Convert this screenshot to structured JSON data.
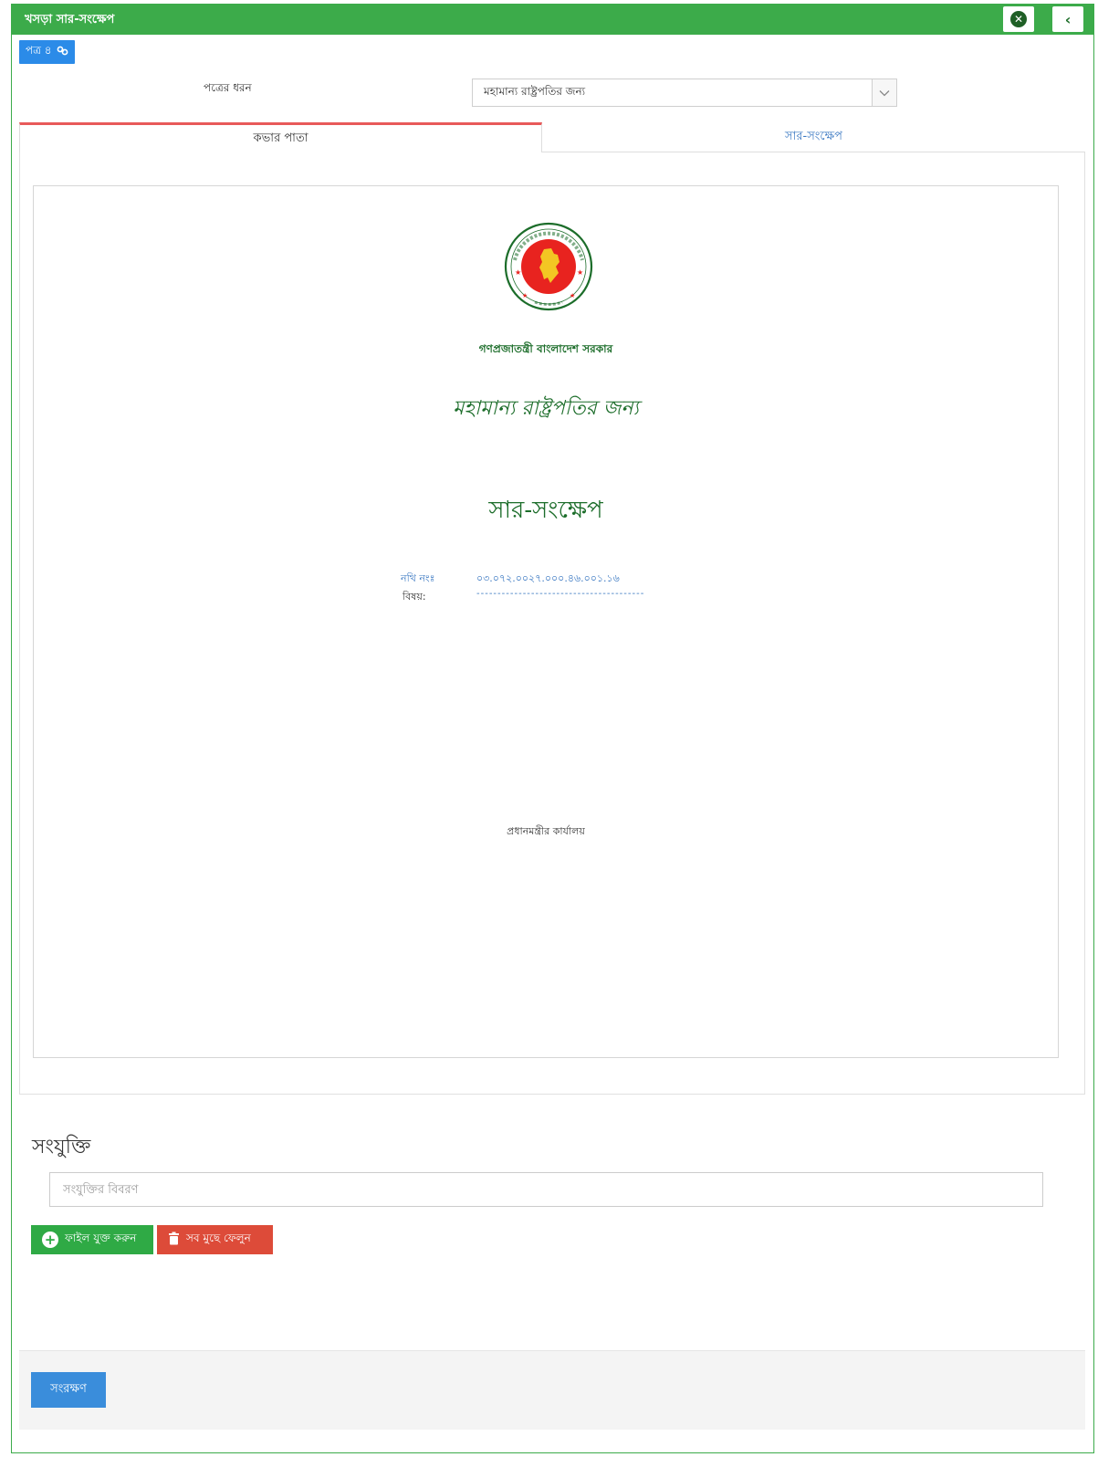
{
  "window": {
    "title": "খসড়া সার-সংক্ষেপ",
    "close_icon": "close-circle-icon",
    "back_icon": "chevron-left-icon"
  },
  "badge": {
    "label": "পত্র ৪",
    "icon": "link-icon"
  },
  "letter_type": {
    "label": "পত্রের ধরন",
    "selected": "মহামান্য রাষ্ট্রপতির জন্য"
  },
  "tabs": [
    {
      "label": "কভার পাতা",
      "active": true
    },
    {
      "label": "সার-সংক্ষেপ",
      "active": false
    }
  ],
  "cover": {
    "emblem": "Government of Bangladesh emblem",
    "emblem_text_top": "গণপ্রজাতন্ত্রী বাংলাদেশ",
    "emblem_text_bottom": "সরকার",
    "government_name": "গণপ্রজাতন্ত্রী বাংলাদেশ সরকার",
    "recipient": "মহামান্য রাষ্ট্রপতির জন্য",
    "doc_title": "সার-সংক্ষেপ",
    "file_no_label": "নথি নংঃ",
    "file_no_value": "০৩.০৭২.০০২৭.০০০.৪৬.০০১.১৬",
    "subject_label": "বিষয়:",
    "subject_value": "----------------------------------------",
    "office": "প্রধানমন্ত্রীর কার্যালয়"
  },
  "attachments": {
    "heading": "সংযুক্তি",
    "placeholder": "সংযুক্তির বিবরণ",
    "add_label": "ফাইল যুক্ত করুন",
    "clear_label": "সব মুছে ফেলুন"
  },
  "footer": {
    "save_label": "সংরক্ষণ"
  },
  "colors": {
    "header_green": "#3cab4a",
    "primary_blue": "#3a8ddb",
    "danger_red": "#dd4b39",
    "emblem_red": "#e8231f",
    "text_green": "#1c6d2a"
  }
}
